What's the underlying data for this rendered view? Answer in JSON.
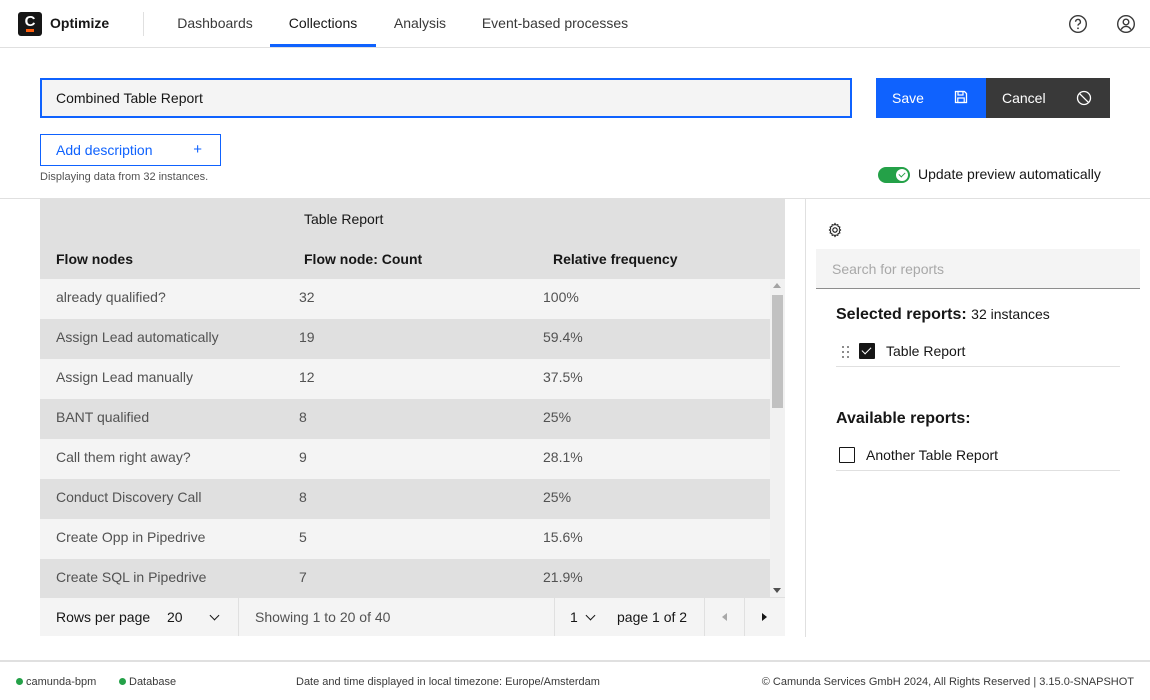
{
  "header": {
    "logo_letter": "C",
    "brand": "Optimize",
    "nav": [
      {
        "label": "Dashboards",
        "active": false
      },
      {
        "label": "Collections",
        "active": true
      },
      {
        "label": "Analysis",
        "active": false
      },
      {
        "label": "Event-based processes",
        "active": false
      }
    ],
    "icons": [
      "help-icon",
      "user-icon"
    ]
  },
  "editor": {
    "report_name": "Combined Table Report",
    "save_label": "Save",
    "cancel_label": "Cancel",
    "add_description_label": "Add description",
    "add_description_icon": "+",
    "instances_note": "Displaying data from 32 instances.",
    "auto_update_label": "Update preview automatically",
    "auto_update_on": true
  },
  "table": {
    "group_header": "Table Report",
    "columns": [
      "Flow nodes",
      "Flow node: Count",
      "Relative frequency"
    ],
    "rows": [
      [
        "already qualified?",
        "32",
        "100%"
      ],
      [
        "Assign Lead automatically",
        "19",
        "59.4%"
      ],
      [
        "Assign Lead manually",
        "12",
        "37.5%"
      ],
      [
        "BANT qualified",
        "8",
        "25%"
      ],
      [
        "Call them right away?",
        "9",
        "28.1%"
      ],
      [
        "Conduct Discovery Call",
        "8",
        "25%"
      ],
      [
        "Create Opp in Pipedrive",
        "5",
        "15.6%"
      ],
      [
        "Create SQL in Pipedrive",
        "7",
        "21.9%"
      ]
    ],
    "pagination": {
      "rows_per_page_label": "Rows per page",
      "rows_per_page": "20",
      "showing": "Showing 1 to 20 of 40",
      "current_page": "1",
      "page_of": "page 1 of 2"
    }
  },
  "panel": {
    "search_placeholder": "Search for reports",
    "selected_heading": "Selected reports:",
    "selected_count": "32 instances",
    "selected_reports": [
      {
        "label": "Table Report",
        "checked": true
      }
    ],
    "available_heading": "Available reports:",
    "available_reports": [
      {
        "label": "Another Table Report",
        "checked": false
      }
    ]
  },
  "footer": {
    "status": [
      {
        "label": "camunda-bpm",
        "color": "#24a148"
      },
      {
        "label": "Database",
        "color": "#24a148"
      }
    ],
    "timezone": "Date and time displayed in local timezone: Europe/Amsterdam",
    "copyright": "© Camunda Services GmbH 2024, All Rights Reserved | 3.15.0-SNAPSHOT"
  }
}
